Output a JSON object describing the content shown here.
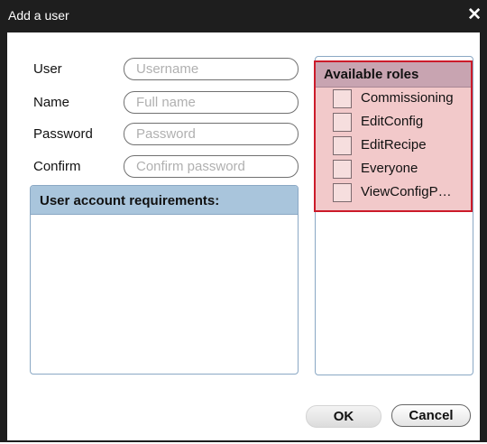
{
  "dialog": {
    "title": "Add a user",
    "close_glyph": "✕",
    "close_icon": "close-icon"
  },
  "form": {
    "user_label": "User",
    "user_placeholder": "Username",
    "user_value": "",
    "name_label": "Name",
    "name_placeholder": "Full name",
    "name_value": "",
    "password_label": "Password",
    "password_placeholder": "Password",
    "password_value": "",
    "confirm_label": "Confirm",
    "confirm_placeholder": "Confirm password",
    "confirm_value": ""
  },
  "requirements": {
    "header": "User account requirements:"
  },
  "roles": {
    "header": "Available roles",
    "items": [
      {
        "label": "Commissioning",
        "checked": false
      },
      {
        "label": "EditConfig",
        "checked": false
      },
      {
        "label": "EditRecipe",
        "checked": false
      },
      {
        "label": "Everyone",
        "checked": false
      },
      {
        "label": "ViewConfigP…",
        "checked": false
      }
    ]
  },
  "buttons": {
    "ok_label": "OK",
    "cancel_label": "Cancel"
  },
  "colors": {
    "titlebar": "#1e1e1e",
    "requirements_header": "#a9c5dc",
    "roles_highlight": "#f2c9ca",
    "roles_highlight_border": "#cc1b2a",
    "roles_header": "#c8a4b1"
  }
}
